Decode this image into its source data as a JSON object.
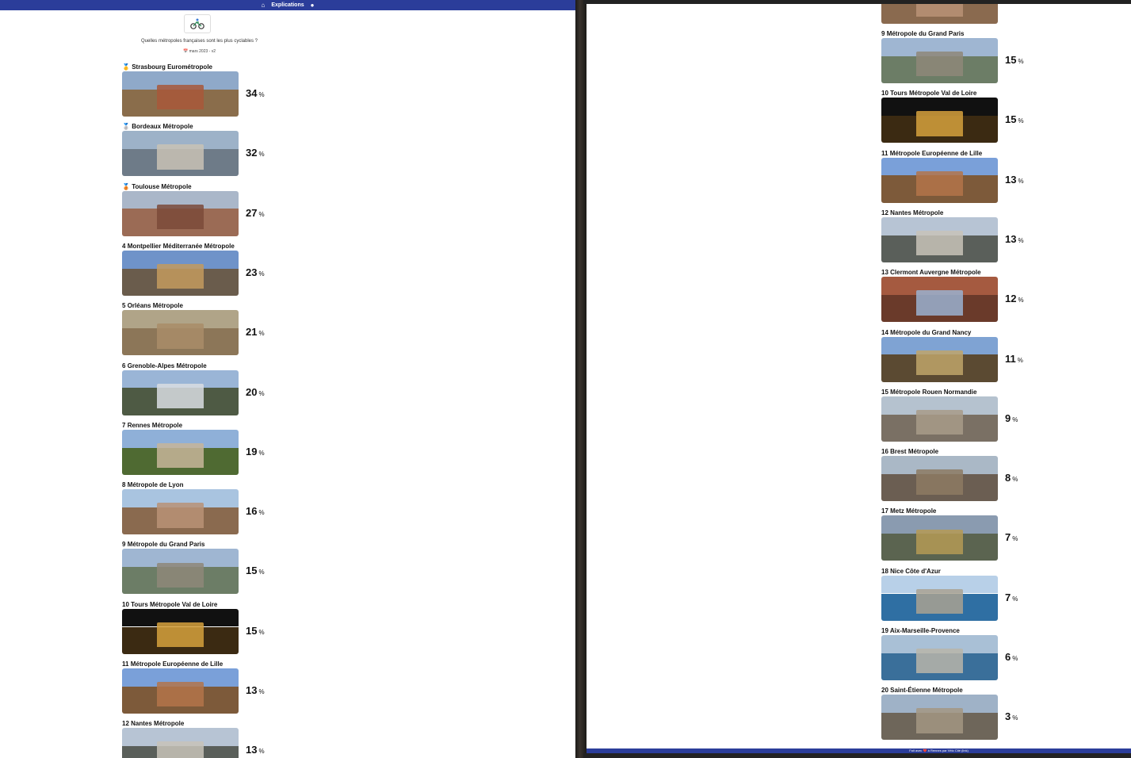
{
  "nav": {
    "explications": "Explications"
  },
  "header": {
    "subtitle": "Quelles métropoles françaises sont les plus cyclables ?",
    "date": "📅 mars 2023 - v2"
  },
  "unit": "%",
  "ranking": [
    {
      "rank": "🥇",
      "name": "Strasbourg Eurométropole",
      "pct": "34",
      "colors": [
        "#8fa9c9",
        "#8a6d4b",
        "#a8583a"
      ]
    },
    {
      "rank": "🥈",
      "name": "Bordeaux Métropole",
      "pct": "32",
      "colors": [
        "#9db2c8",
        "#6e7b88",
        "#c9c2b5"
      ]
    },
    {
      "rank": "🥉",
      "name": "Toulouse Métropole",
      "pct": "27",
      "colors": [
        "#aab7c9",
        "#9b6b55",
        "#7b4a39"
      ]
    },
    {
      "rank": "4",
      "name": "Montpellier Méditerranée Métropole",
      "pct": "23",
      "colors": [
        "#6f93c9",
        "#6a5c4c",
        "#c39a5e"
      ]
    },
    {
      "rank": "5",
      "name": "Orléans Métropole",
      "pct": "21",
      "colors": [
        "#b0a488",
        "#8c7658",
        "#a98d68"
      ]
    },
    {
      "rank": "6",
      "name": "Grenoble-Alpes Métropole",
      "pct": "20",
      "colors": [
        "#9ab5d6",
        "#4e5a44",
        "#d9dde2"
      ]
    },
    {
      "rank": "7",
      "name": "Rennes Métropole",
      "pct": "19",
      "colors": [
        "#8fb0d8",
        "#4f6a32",
        "#c7b59a"
      ]
    },
    {
      "rank": "8",
      "name": "Métropole de Lyon",
      "pct": "16",
      "colors": [
        "#a9c4e0",
        "#8a6a4f",
        "#b89275"
      ]
    },
    {
      "rank": "9",
      "name": "Métropole du Grand Paris",
      "pct": "15",
      "colors": [
        "#9fb6d2",
        "#6c7d66",
        "#8e8779"
      ]
    },
    {
      "rank": "10",
      "name": "Tours Métropole Val de Loire",
      "pct": "15",
      "colors": [
        "#111111",
        "#3b2a12",
        "#d6a13d"
      ]
    },
    {
      "rank": "11",
      "name": "Métropole Européenne de Lille",
      "pct": "13",
      "colors": [
        "#7aa0d9",
        "#7d5a3a",
        "#b3744a"
      ]
    },
    {
      "rank": "12",
      "name": "Nantes Métropole",
      "pct": "13",
      "colors": [
        "#b7c4d4",
        "#5a5f5a",
        "#c8c3b9"
      ]
    },
    {
      "rank": "13",
      "name": "Clermont Auvergne Métropole",
      "pct": "12",
      "colors": [
        "#a55a40",
        "#6a3a2a",
        "#9ab1d0"
      ]
    },
    {
      "rank": "14",
      "name": "Métropole du Grand Nancy",
      "pct": "11",
      "colors": [
        "#7fa3d3",
        "#5b4a32",
        "#c0a46a"
      ]
    },
    {
      "rank": "15",
      "name": "Métropole Rouen Normandie",
      "pct": "9",
      "colors": [
        "#b5c2cf",
        "#7a7064",
        "#a89b88"
      ]
    },
    {
      "rank": "16",
      "name": "Brest Métropole",
      "pct": "8",
      "colors": [
        "#aab8c6",
        "#6b5e52",
        "#8d7a63"
      ]
    },
    {
      "rank": "17",
      "name": "Metz Métropole",
      "pct": "7",
      "colors": [
        "#8a9bb0",
        "#5b6450",
        "#b59a55"
      ]
    },
    {
      "rank": "18",
      "name": "Nice Côte d'Azur",
      "pct": "7",
      "colors": [
        "#b8d0e8",
        "#2f6fa3",
        "#a9a292"
      ]
    },
    {
      "rank": "19",
      "name": "Aix-Marseille-Provence",
      "pct": "6",
      "colors": [
        "#a9c0d6",
        "#3a6f9a",
        "#b9b5a9"
      ]
    },
    {
      "rank": "20",
      "name": "Saint-Étienne Métropole",
      "pct": "3",
      "colors": [
        "#9fb2c7",
        "#6e665a",
        "#a39683"
      ]
    }
  ],
  "footer": {
    "text": "Fait avec ❤️ à Rennes par Vélo Cité (link)"
  }
}
